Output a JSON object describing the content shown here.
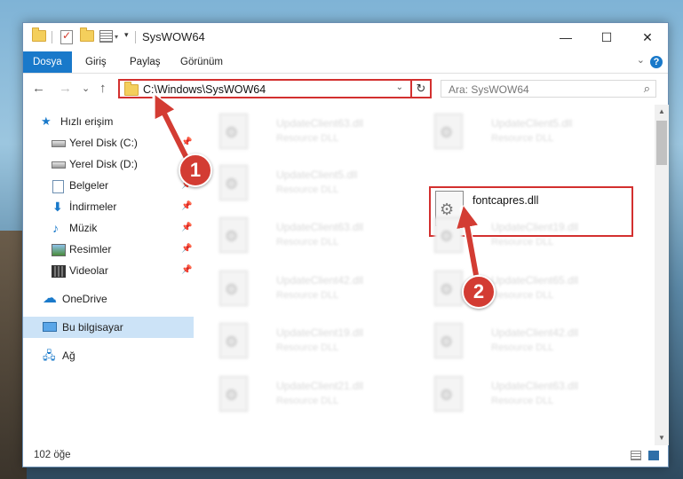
{
  "window": {
    "title": "SysWOW64",
    "controls": {
      "minimize": "—",
      "maximize": "☐",
      "close": "✕"
    }
  },
  "ribbon": {
    "tabs": [
      "Dosya",
      "Giriş",
      "Paylaş",
      "Görünüm"
    ],
    "help": "?"
  },
  "nav": {
    "back": "←",
    "forward": "→",
    "recent": "⌄",
    "up": "↑",
    "address": "C:\\Windows\\SysWOW64",
    "refresh_icon": "↻",
    "search_placeholder": "Ara: SysWOW64"
  },
  "sidebar": {
    "items": [
      {
        "label": "Hızlı erişim",
        "icon": "star-icon"
      },
      {
        "label": "Yerel Disk (C:)",
        "icon": "drive-icon",
        "pinned": true
      },
      {
        "label": "Yerel Disk (D:)",
        "icon": "drive-icon",
        "pinned": true
      },
      {
        "label": "Belgeler",
        "icon": "documents-icon",
        "pinned": true
      },
      {
        "label": "İndirmeler",
        "icon": "download-icon",
        "pinned": true
      },
      {
        "label": "Müzik",
        "icon": "music-icon",
        "pinned": true
      },
      {
        "label": "Resimler",
        "icon": "pictures-icon",
        "pinned": true
      },
      {
        "label": "Videolar",
        "icon": "videos-icon",
        "pinned": true
      },
      {
        "label": "OneDrive",
        "icon": "cloud-icon"
      },
      {
        "label": "Bu bilgisayar",
        "icon": "pc-icon",
        "selected": true
      },
      {
        "label": "Ağ",
        "icon": "network-icon"
      }
    ]
  },
  "files": {
    "left_column": [
      {
        "name": "UpdateClient63.dll",
        "desc": "Resource DLL"
      },
      {
        "name": "UpdateClient5.dll",
        "desc": "Resource DLL"
      },
      {
        "name": "UpdateClient63.dll",
        "desc": "Resource DLL"
      },
      {
        "name": "UpdateClient42.dll",
        "desc": "Resource DLL"
      },
      {
        "name": "UpdateClient19.dll",
        "desc": "Resource DLL"
      },
      {
        "name": "UpdateClient21.dll",
        "desc": "Resource DLL"
      }
    ],
    "right_column": [
      {
        "name": "UpdateClient5.dll",
        "desc": "Resource DLL"
      },
      {
        "name": "UpdateClient19.dll",
        "desc": "Resource DLL"
      },
      {
        "name": "UpdateClient65.dll",
        "desc": "Resource DLL"
      },
      {
        "name": "UpdateClient42.dll",
        "desc": "Resource DLL"
      },
      {
        "name": "UpdateClient63.dll",
        "desc": "Resource DLL"
      }
    ],
    "highlighted": {
      "name": "fontcapres.dll"
    }
  },
  "status": {
    "count": "102 öğe"
  },
  "annotations": {
    "step1": "1",
    "step2": "2",
    "color": "#d33c33"
  }
}
